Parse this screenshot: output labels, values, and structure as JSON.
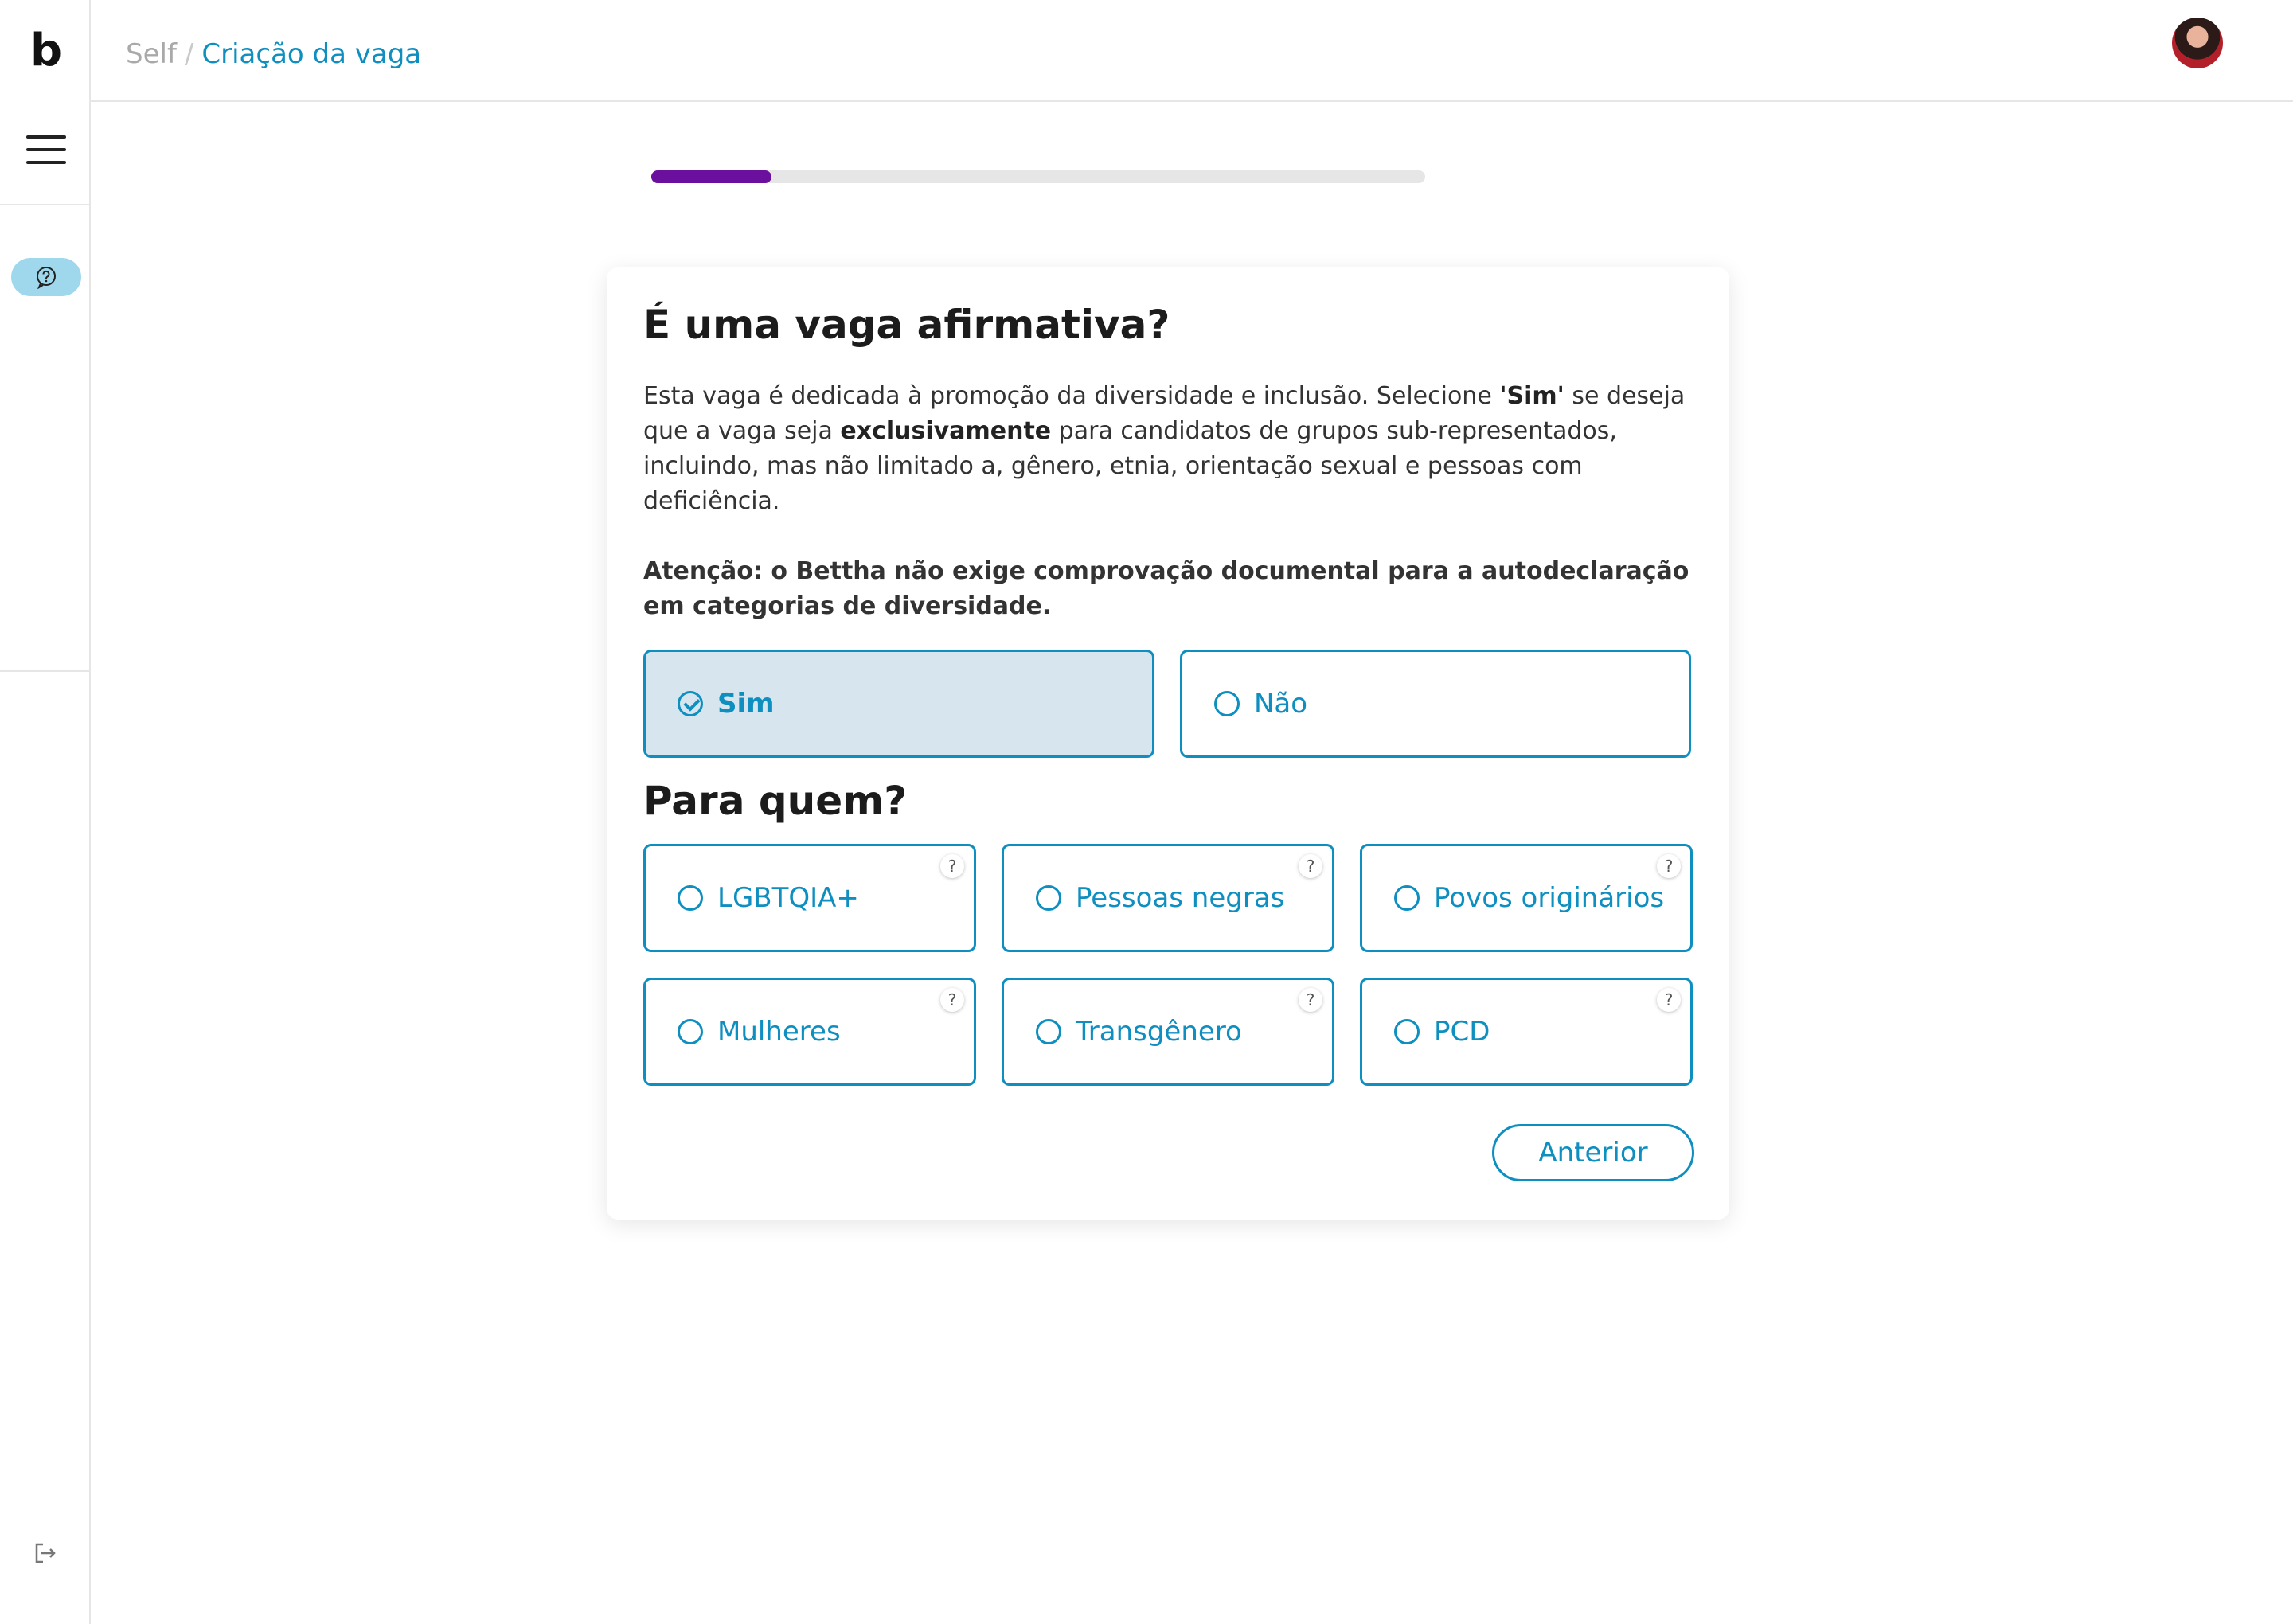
{
  "app": {
    "logo": "b"
  },
  "breadcrumb": {
    "root": "Self",
    "separator": "/",
    "current": "Criação da vaga"
  },
  "progress": {
    "fraction": 0.155
  },
  "card": {
    "title": "É uma vaga afirmativa?",
    "description": {
      "p1": "Esta vaga é dedicada à promoção da diversidade e inclusão. Selecione ",
      "b1": "'Sim'",
      "p2": " se deseja que a vaga seja ",
      "b2": "exclusivamente",
      "p3": " para candidatos de grupos sub-representados, incluindo, mas não limitado a, gênero, etnia, orientação sexual e pessoas com deficiência."
    },
    "warning": "Atenção: o Bettha não exige comprovação documental para a autodeclaração em categorias de diversidade.",
    "options": {
      "yes": "Sim",
      "no": "Não",
      "selected": "yes"
    },
    "for_whom_title": "Para quem?",
    "categories": [
      {
        "label": "LGBTQIA+",
        "help": "?"
      },
      {
        "label": "Pessoas negras",
        "help": "?"
      },
      {
        "label": "Povos originários",
        "help": "?"
      },
      {
        "label": "Mulheres",
        "help": "?"
      },
      {
        "label": "Transgênero",
        "help": "?"
      },
      {
        "label": "PCD",
        "help": "?"
      }
    ],
    "previous_button": "Anterior"
  },
  "colors": {
    "accent": "#0f8fc0",
    "progress": "#6a0f9e",
    "selected_bg": "#d7e6ee"
  }
}
